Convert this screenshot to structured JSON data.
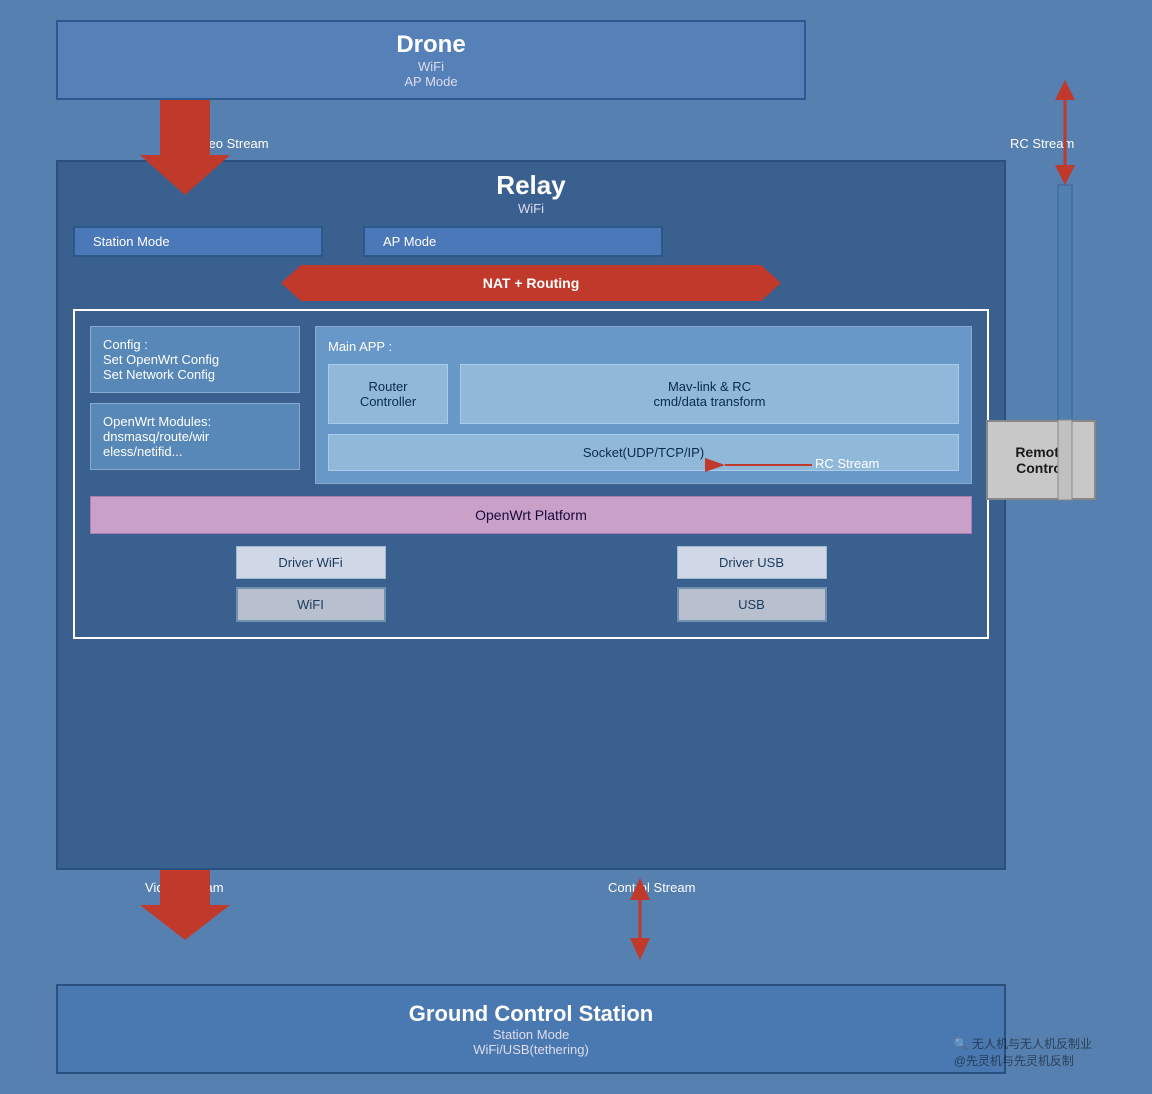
{
  "drone": {
    "title": "Drone",
    "line1": "WiFi",
    "line2": "AP Mode"
  },
  "relay": {
    "title": "Relay",
    "subtitle": "WiFi",
    "station_mode": "Station Mode",
    "ap_mode": "AP Mode",
    "nat_routing": "NAT + Routing",
    "config_box": {
      "line1": "Config :",
      "line2": "Set OpenWrt Config",
      "line3": "Set Network Config"
    },
    "modules_box": {
      "line1": "OpenWrt Modules:",
      "line2": "dnsmasq/route/wir",
      "line3": "eless/netifid..."
    },
    "main_app": "Main APP :",
    "router_controller": {
      "line1": "Router",
      "line2": "Controller"
    },
    "mavlink": {
      "line1": "Mav-link & RC",
      "line2": "cmd/data transform"
    },
    "socket": "Socket(UDP/TCP/IP)",
    "platform": "OpenWrt Platform",
    "driver_wifi": "Driver WiFi",
    "wifi": "WiFI",
    "driver_usb": "Driver USB",
    "usb": "USB"
  },
  "remote_control": {
    "line1": "Remote",
    "line2": "Control"
  },
  "labels": {
    "video_stream_top": "Video Stream",
    "rc_stream_top": "RC Stream",
    "rc_stream_mid": "RC Stream",
    "video_stream_bottom": "Video Stream",
    "control_stream": "Control Stream"
  },
  "gcs": {
    "title": "Ground Control Station",
    "line1": "Station Mode",
    "line2": "WiFi/USB(tethering)"
  },
  "watermark": {
    "text1": "无人机与无人机反制业",
    "text2": "@先灵机与先灵机反制"
  }
}
